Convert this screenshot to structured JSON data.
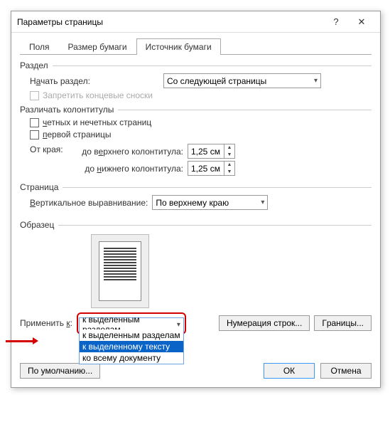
{
  "window": {
    "title": "Параметры страницы"
  },
  "tabs": {
    "t1": "Поля",
    "t2": "Размер бумаги",
    "t3": "Источник бумаги"
  },
  "section": {
    "group": "Раздел",
    "startLabelPre": "Н",
    "startLabelAccel": "а",
    "startLabelPost": "чать раздел:",
    "startValue": "Со следующей страницы",
    "suppressEndnotes": "Запретить концевые сноски"
  },
  "hf": {
    "group": "Различать колонтитулы",
    "oddEvenPre": "",
    "oddEvenAccel": "ч",
    "oddEvenPost": "етных и нечетных страниц",
    "firstPagePre": "",
    "firstPageAccel": "п",
    "firstPagePost": "ервой страницы",
    "edgeLabel": "От края:",
    "headerLabelPre": "до в",
    "headerAccel": "е",
    "headerLabelPost": "рхнего колонтитула:",
    "footerLabelPre": "до ",
    "footerAccel": "н",
    "footerLabelPost": "ижнего колонтитула:",
    "headerValue": "1,25 см",
    "footerValue": "1,25 см"
  },
  "page": {
    "group": "Страница",
    "valignLabelPre": "",
    "valignAccel": "В",
    "valignLabelPost": "ертикальное выравнивание:",
    "valignValue": "По верхнему краю"
  },
  "sample": {
    "group": "Образец"
  },
  "apply": {
    "labelPre": "Применить ",
    "labelAccel": "к",
    "labelPost": ":",
    "value": "к выделенным разделам",
    "opt1": "к выделенным разделам",
    "opt2": "к выделенному тексту",
    "opt3": "ко всему документу"
  },
  "buttons": {
    "lineNumbers": "Нумерация строк...",
    "bordersPre": "",
    "bordersAccel": "Г",
    "bordersPost": "раницы...",
    "default": "По умолчанию...",
    "ok": "ОК",
    "cancel": "Отмена"
  }
}
